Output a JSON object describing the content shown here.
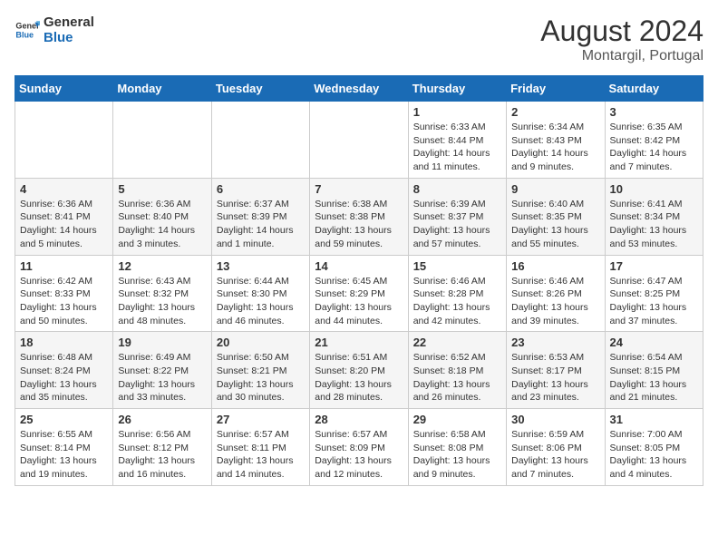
{
  "header": {
    "logo_line1": "General",
    "logo_line2": "Blue",
    "month_year": "August 2024",
    "location": "Montargil, Portugal"
  },
  "days_of_week": [
    "Sunday",
    "Monday",
    "Tuesday",
    "Wednesday",
    "Thursday",
    "Friday",
    "Saturday"
  ],
  "weeks": [
    [
      {
        "day": "",
        "info": ""
      },
      {
        "day": "",
        "info": ""
      },
      {
        "day": "",
        "info": ""
      },
      {
        "day": "",
        "info": ""
      },
      {
        "day": "1",
        "info": "Sunrise: 6:33 AM\nSunset: 8:44 PM\nDaylight: 14 hours and 11 minutes."
      },
      {
        "day": "2",
        "info": "Sunrise: 6:34 AM\nSunset: 8:43 PM\nDaylight: 14 hours and 9 minutes."
      },
      {
        "day": "3",
        "info": "Sunrise: 6:35 AM\nSunset: 8:42 PM\nDaylight: 14 hours and 7 minutes."
      }
    ],
    [
      {
        "day": "4",
        "info": "Sunrise: 6:36 AM\nSunset: 8:41 PM\nDaylight: 14 hours and 5 minutes."
      },
      {
        "day": "5",
        "info": "Sunrise: 6:36 AM\nSunset: 8:40 PM\nDaylight: 14 hours and 3 minutes."
      },
      {
        "day": "6",
        "info": "Sunrise: 6:37 AM\nSunset: 8:39 PM\nDaylight: 14 hours and 1 minute."
      },
      {
        "day": "7",
        "info": "Sunrise: 6:38 AM\nSunset: 8:38 PM\nDaylight: 13 hours and 59 minutes."
      },
      {
        "day": "8",
        "info": "Sunrise: 6:39 AM\nSunset: 8:37 PM\nDaylight: 13 hours and 57 minutes."
      },
      {
        "day": "9",
        "info": "Sunrise: 6:40 AM\nSunset: 8:35 PM\nDaylight: 13 hours and 55 minutes."
      },
      {
        "day": "10",
        "info": "Sunrise: 6:41 AM\nSunset: 8:34 PM\nDaylight: 13 hours and 53 minutes."
      }
    ],
    [
      {
        "day": "11",
        "info": "Sunrise: 6:42 AM\nSunset: 8:33 PM\nDaylight: 13 hours and 50 minutes."
      },
      {
        "day": "12",
        "info": "Sunrise: 6:43 AM\nSunset: 8:32 PM\nDaylight: 13 hours and 48 minutes."
      },
      {
        "day": "13",
        "info": "Sunrise: 6:44 AM\nSunset: 8:30 PM\nDaylight: 13 hours and 46 minutes."
      },
      {
        "day": "14",
        "info": "Sunrise: 6:45 AM\nSunset: 8:29 PM\nDaylight: 13 hours and 44 minutes."
      },
      {
        "day": "15",
        "info": "Sunrise: 6:46 AM\nSunset: 8:28 PM\nDaylight: 13 hours and 42 minutes."
      },
      {
        "day": "16",
        "info": "Sunrise: 6:46 AM\nSunset: 8:26 PM\nDaylight: 13 hours and 39 minutes."
      },
      {
        "day": "17",
        "info": "Sunrise: 6:47 AM\nSunset: 8:25 PM\nDaylight: 13 hours and 37 minutes."
      }
    ],
    [
      {
        "day": "18",
        "info": "Sunrise: 6:48 AM\nSunset: 8:24 PM\nDaylight: 13 hours and 35 minutes."
      },
      {
        "day": "19",
        "info": "Sunrise: 6:49 AM\nSunset: 8:22 PM\nDaylight: 13 hours and 33 minutes."
      },
      {
        "day": "20",
        "info": "Sunrise: 6:50 AM\nSunset: 8:21 PM\nDaylight: 13 hours and 30 minutes."
      },
      {
        "day": "21",
        "info": "Sunrise: 6:51 AM\nSunset: 8:20 PM\nDaylight: 13 hours and 28 minutes."
      },
      {
        "day": "22",
        "info": "Sunrise: 6:52 AM\nSunset: 8:18 PM\nDaylight: 13 hours and 26 minutes."
      },
      {
        "day": "23",
        "info": "Sunrise: 6:53 AM\nSunset: 8:17 PM\nDaylight: 13 hours and 23 minutes."
      },
      {
        "day": "24",
        "info": "Sunrise: 6:54 AM\nSunset: 8:15 PM\nDaylight: 13 hours and 21 minutes."
      }
    ],
    [
      {
        "day": "25",
        "info": "Sunrise: 6:55 AM\nSunset: 8:14 PM\nDaylight: 13 hours and 19 minutes."
      },
      {
        "day": "26",
        "info": "Sunrise: 6:56 AM\nSunset: 8:12 PM\nDaylight: 13 hours and 16 minutes."
      },
      {
        "day": "27",
        "info": "Sunrise: 6:57 AM\nSunset: 8:11 PM\nDaylight: 13 hours and 14 minutes."
      },
      {
        "day": "28",
        "info": "Sunrise: 6:57 AM\nSunset: 8:09 PM\nDaylight: 13 hours and 12 minutes."
      },
      {
        "day": "29",
        "info": "Sunrise: 6:58 AM\nSunset: 8:08 PM\nDaylight: 13 hours and 9 minutes."
      },
      {
        "day": "30",
        "info": "Sunrise: 6:59 AM\nSunset: 8:06 PM\nDaylight: 13 hours and 7 minutes."
      },
      {
        "day": "31",
        "info": "Sunrise: 7:00 AM\nSunset: 8:05 PM\nDaylight: 13 hours and 4 minutes."
      }
    ]
  ]
}
